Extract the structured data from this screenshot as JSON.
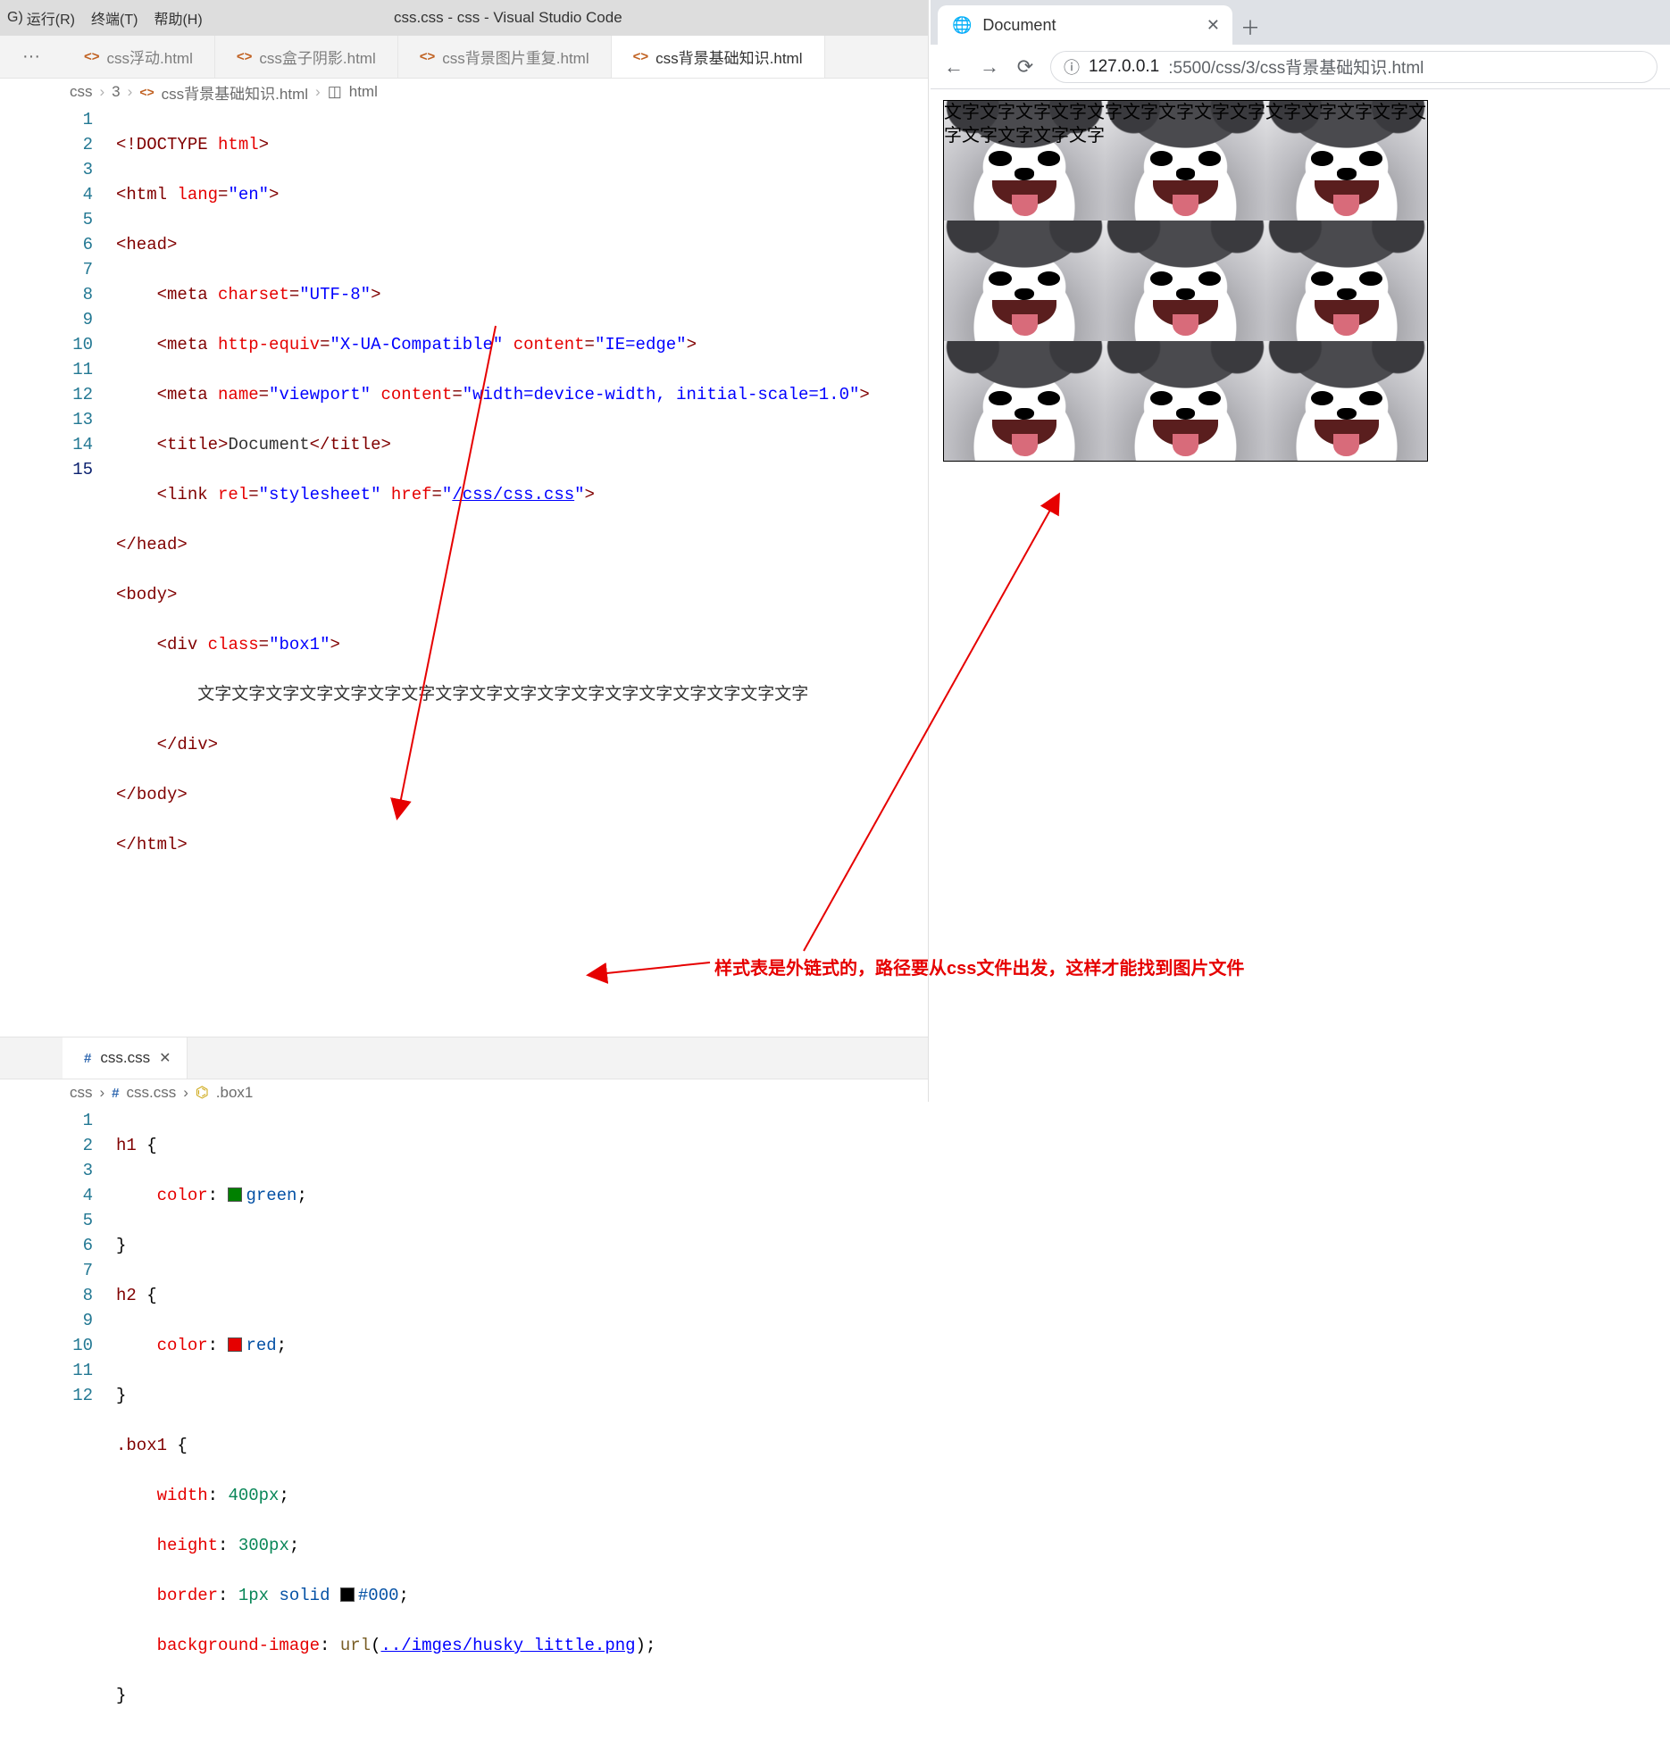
{
  "menubar": {
    "menus": [
      "运行(R)",
      "终端(T)",
      "帮助(H)"
    ],
    "leading": "G)",
    "title": "css.css - css - Visual Studio Code"
  },
  "editor_tabs": [
    {
      "label": "css浮动.html",
      "active": false
    },
    {
      "label": "css盒子阴影.html",
      "active": false
    },
    {
      "label": "css背景图片重复.html",
      "active": false
    },
    {
      "label": "css背景基础知识.html",
      "active": true
    }
  ],
  "breadcrumb1": {
    "seg1": "css",
    "seg2": "3",
    "seg3": "css背景基础知识.html",
    "seg4": "html"
  },
  "html_code": {
    "lines": [
      "1",
      "2",
      "3",
      "4",
      "5",
      "6",
      "7",
      "8",
      "9",
      "10",
      "11",
      "12",
      "13",
      "14",
      "15"
    ],
    "l1_doctype": "<!DOCTYPE ",
    "l1_html": "html",
    "l1_end": ">",
    "l2_open": "<",
    "l2_tag": "html",
    "l2_sp": " ",
    "l2_attr": "lang",
    "l2_eq": "=",
    "l2_val": "\"en\"",
    "l2_close": ">",
    "l3": "<head>",
    "l4_open": "<",
    "l4_tag": "meta",
    "l4_sp": " ",
    "l4_attr": "charset",
    "l4_eq": "=",
    "l4_val": "\"UTF-8\"",
    "l4_close": ">",
    "l5_open": "<",
    "l5_tag": "meta",
    "l5_sp1": " ",
    "l5_attr1": "http-equiv",
    "l5_eq1": "=",
    "l5_val1": "\"X-UA-Compatible\"",
    "l5_sp2": " ",
    "l5_attr2": "content",
    "l5_eq2": "=",
    "l5_val2": "\"IE=edge\"",
    "l5_close": ">",
    "l6_open": "<",
    "l6_tag": "meta",
    "l6_sp1": " ",
    "l6_attr1": "name",
    "l6_eq1": "=",
    "l6_val1": "\"viewport\"",
    "l6_sp2": " ",
    "l6_attr2": "content",
    "l6_eq2": "=",
    "l6_val2": "\"width=device-width, initial-scale=1.0\"",
    "l6_close": ">",
    "l7_open": "<",
    "l7_tag": "title",
    "l7_close1": ">",
    "l7_txt": "Document",
    "l7_open2": "</",
    "l7_tag2": "title",
    "l7_close2": ">",
    "l8_open": "<",
    "l8_tag": "link",
    "l8_sp1": " ",
    "l8_attr1": "rel",
    "l8_eq1": "=",
    "l8_val1": "\"stylesheet\"",
    "l8_sp2": " ",
    "l8_attr2": "href",
    "l8_eq2": "=",
    "l8_q1": "\"",
    "l8_url": "/css/css.css",
    "l8_q2": "\"",
    "l8_close": ">",
    "l9": "</head>",
    "l10": "<body>",
    "l11_open": "<",
    "l11_tag": "div",
    "l11_sp": " ",
    "l11_attr": "class",
    "l11_eq": "=",
    "l11_val": "\"box1\"",
    "l11_close": ">",
    "l12_txt": "文字文字文字文字文字文字文字文字文字文字文字文字文字文字文字文字文字文字",
    "l13": "</div>",
    "l14": "</body>",
    "l15": "</html>"
  },
  "tab2": {
    "label": "css.css"
  },
  "breadcrumb2": {
    "seg1": "css",
    "seg2": "css.css",
    "seg3": ".box1"
  },
  "css_code": {
    "lines": [
      "1",
      "2",
      "3",
      "4",
      "5",
      "6",
      "7",
      "8",
      "9",
      "10",
      "11",
      "12"
    ],
    "l1_sel": "h1",
    "l1_b": " {",
    "l2_prop": "color",
    "l2_colon": ": ",
    "l2_val": "green",
    "l2_semi": ";",
    "l3_b": "}",
    "l4_sel": "h2",
    "l4_b": " {",
    "l5_prop": "color",
    "l5_colon": ": ",
    "l5_val": "red",
    "l5_semi": ";",
    "l6_b": "}",
    "l7_sel": ".box1",
    "l7_b": " {",
    "l8_prop": "width",
    "l8_colon": ": ",
    "l8_val": "400px",
    "l8_semi": ";",
    "l9_prop": "height",
    "l9_colon": ": ",
    "l9_val": "300px",
    "l9_semi": ";",
    "l10_prop": "border",
    "l10_colon": ": ",
    "l10_val1": "1px",
    "l10_sp1": " ",
    "l10_val2": "solid",
    "l10_sp2": " ",
    "l10_val3": "#000",
    "l10_semi": ";",
    "l11_prop": "background-image",
    "l11_colon": ": ",
    "l11_func": "url",
    "l11_p1": "(",
    "l11_url": "../imges/husky_little.png",
    "l11_p2": ")",
    "l11_semi": ";",
    "l12_b": "}"
  },
  "browser": {
    "tab_title": "Document",
    "url_host": "127.0.0.1",
    "url_port_path": ":5500/css/3/css背景基础知识.html",
    "box_text": "文字文字文字文字文字文字文字文字文字文字文字文字文字文字文字文字文字文字"
  },
  "annotation": "样式表是外链式的，路径要从css文件出发，这样才能找到图片文件",
  "colors": {
    "green": "#008000",
    "red": "#e50000",
    "black": "#000000"
  }
}
